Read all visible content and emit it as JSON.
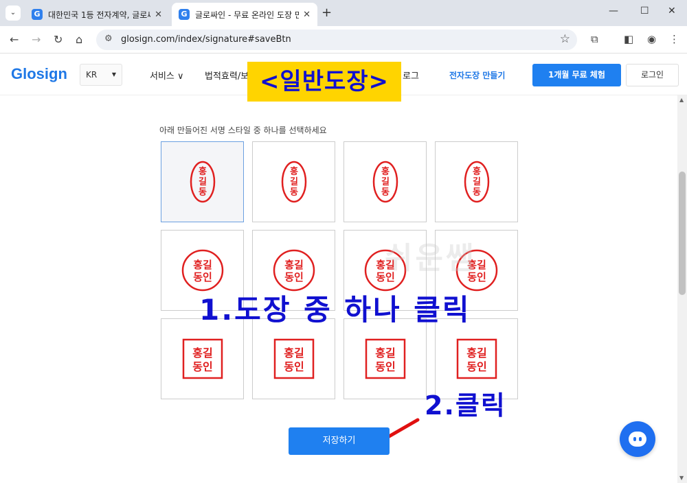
{
  "browser": {
    "tabs": [
      {
        "title": "대한민국 1등 전자계약, 글로싸",
        "favicon": "G",
        "active": false
      },
      {
        "title": "글로싸인 - 무료 온라인 도장 만",
        "favicon": "G",
        "active": true
      }
    ],
    "url": "glosign.com/index/signature#saveBtn"
  },
  "header": {
    "logo": "Glosign",
    "lang": "KR",
    "nav": [
      "서비스 ∨",
      "법적효력/보",
      "로그"
    ],
    "make_link": "전자도장 만들기",
    "trial_button": "1개월 무료 체험",
    "login_button": "로그인"
  },
  "banner": "<일반도장>",
  "instructions": "아래 만들어진 서명 스타일 중 하나를 선택하세요",
  "stamps": [
    {
      "style": "oval-vertical",
      "lines": [
        "홍",
        "길",
        "동"
      ],
      "selected": true
    },
    {
      "style": "oval-vertical",
      "lines": [
        "홍",
        "길",
        "동"
      ],
      "selected": false
    },
    {
      "style": "oval-vertical",
      "lines": [
        "홍",
        "길",
        "동"
      ],
      "selected": false
    },
    {
      "style": "oval-vertical",
      "lines": [
        "홍",
        "길",
        "동"
      ],
      "selected": false
    },
    {
      "style": "circle",
      "lines": [
        "홍길",
        "동인"
      ],
      "selected": false
    },
    {
      "style": "circle",
      "lines": [
        "홍길",
        "동인"
      ],
      "selected": false
    },
    {
      "style": "circle",
      "lines": [
        "홍길",
        "동인"
      ],
      "selected": false
    },
    {
      "style": "circle",
      "lines": [
        "홍길",
        "동인"
      ],
      "selected": false
    },
    {
      "style": "square",
      "lines": [
        "홍길",
        "동인"
      ],
      "selected": false
    },
    {
      "style": "square",
      "lines": [
        "홍길",
        "동인"
      ],
      "selected": false
    },
    {
      "style": "square",
      "lines": [
        "홍길",
        "동인"
      ],
      "selected": false
    },
    {
      "style": "square",
      "lines": [
        "홍길",
        "동인"
      ],
      "selected": false
    }
  ],
  "annotations": {
    "step1": "1.도장 중 하나 클릭",
    "step2": "2.클릭",
    "watermark": "쉬운쌤"
  },
  "save_button": "저장하기",
  "colors": {
    "accent": "#1f80f0",
    "stamp": "#e02020",
    "annotation": "#1010d0",
    "banner_bg": "#ffd400"
  }
}
